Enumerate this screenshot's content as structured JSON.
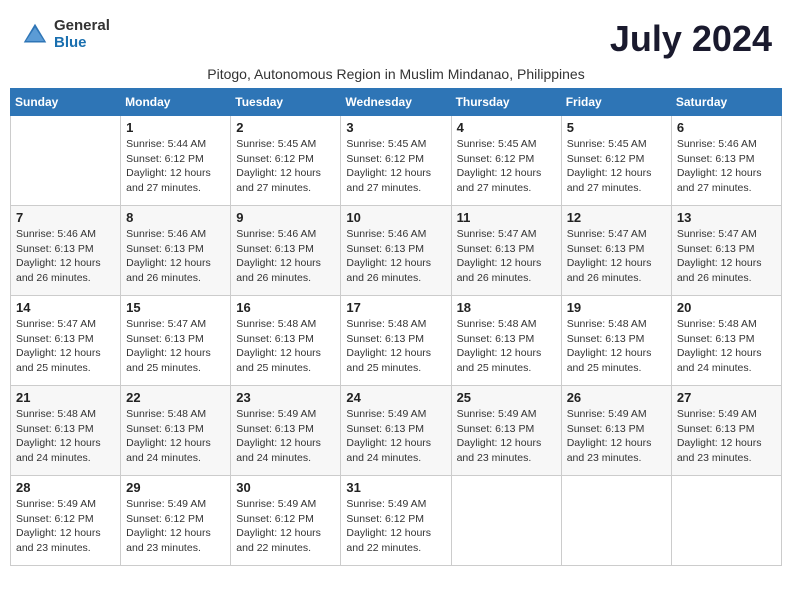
{
  "logo": {
    "general": "General",
    "blue": "Blue"
  },
  "title": "July 2024",
  "subtitle": "Pitogo, Autonomous Region in Muslim Mindanao, Philippines",
  "weekdays": [
    "Sunday",
    "Monday",
    "Tuesday",
    "Wednesday",
    "Thursday",
    "Friday",
    "Saturday"
  ],
  "weeks": [
    [
      {
        "day": "",
        "info": ""
      },
      {
        "day": "1",
        "info": "Sunrise: 5:44 AM\nSunset: 6:12 PM\nDaylight: 12 hours\nand 27 minutes."
      },
      {
        "day": "2",
        "info": "Sunrise: 5:45 AM\nSunset: 6:12 PM\nDaylight: 12 hours\nand 27 minutes."
      },
      {
        "day": "3",
        "info": "Sunrise: 5:45 AM\nSunset: 6:12 PM\nDaylight: 12 hours\nand 27 minutes."
      },
      {
        "day": "4",
        "info": "Sunrise: 5:45 AM\nSunset: 6:12 PM\nDaylight: 12 hours\nand 27 minutes."
      },
      {
        "day": "5",
        "info": "Sunrise: 5:45 AM\nSunset: 6:12 PM\nDaylight: 12 hours\nand 27 minutes."
      },
      {
        "day": "6",
        "info": "Sunrise: 5:46 AM\nSunset: 6:13 PM\nDaylight: 12 hours\nand 27 minutes."
      }
    ],
    [
      {
        "day": "7",
        "info": "Sunrise: 5:46 AM\nSunset: 6:13 PM\nDaylight: 12 hours\nand 26 minutes."
      },
      {
        "day": "8",
        "info": "Sunrise: 5:46 AM\nSunset: 6:13 PM\nDaylight: 12 hours\nand 26 minutes."
      },
      {
        "day": "9",
        "info": "Sunrise: 5:46 AM\nSunset: 6:13 PM\nDaylight: 12 hours\nand 26 minutes."
      },
      {
        "day": "10",
        "info": "Sunrise: 5:46 AM\nSunset: 6:13 PM\nDaylight: 12 hours\nand 26 minutes."
      },
      {
        "day": "11",
        "info": "Sunrise: 5:47 AM\nSunset: 6:13 PM\nDaylight: 12 hours\nand 26 minutes."
      },
      {
        "day": "12",
        "info": "Sunrise: 5:47 AM\nSunset: 6:13 PM\nDaylight: 12 hours\nand 26 minutes."
      },
      {
        "day": "13",
        "info": "Sunrise: 5:47 AM\nSunset: 6:13 PM\nDaylight: 12 hours\nand 26 minutes."
      }
    ],
    [
      {
        "day": "14",
        "info": "Sunrise: 5:47 AM\nSunset: 6:13 PM\nDaylight: 12 hours\nand 25 minutes."
      },
      {
        "day": "15",
        "info": "Sunrise: 5:47 AM\nSunset: 6:13 PM\nDaylight: 12 hours\nand 25 minutes."
      },
      {
        "day": "16",
        "info": "Sunrise: 5:48 AM\nSunset: 6:13 PM\nDaylight: 12 hours\nand 25 minutes."
      },
      {
        "day": "17",
        "info": "Sunrise: 5:48 AM\nSunset: 6:13 PM\nDaylight: 12 hours\nand 25 minutes."
      },
      {
        "day": "18",
        "info": "Sunrise: 5:48 AM\nSunset: 6:13 PM\nDaylight: 12 hours\nand 25 minutes."
      },
      {
        "day": "19",
        "info": "Sunrise: 5:48 AM\nSunset: 6:13 PM\nDaylight: 12 hours\nand 25 minutes."
      },
      {
        "day": "20",
        "info": "Sunrise: 5:48 AM\nSunset: 6:13 PM\nDaylight: 12 hours\nand 24 minutes."
      }
    ],
    [
      {
        "day": "21",
        "info": "Sunrise: 5:48 AM\nSunset: 6:13 PM\nDaylight: 12 hours\nand 24 minutes."
      },
      {
        "day": "22",
        "info": "Sunrise: 5:48 AM\nSunset: 6:13 PM\nDaylight: 12 hours\nand 24 minutes."
      },
      {
        "day": "23",
        "info": "Sunrise: 5:49 AM\nSunset: 6:13 PM\nDaylight: 12 hours\nand 24 minutes."
      },
      {
        "day": "24",
        "info": "Sunrise: 5:49 AM\nSunset: 6:13 PM\nDaylight: 12 hours\nand 24 minutes."
      },
      {
        "day": "25",
        "info": "Sunrise: 5:49 AM\nSunset: 6:13 PM\nDaylight: 12 hours\nand 23 minutes."
      },
      {
        "day": "26",
        "info": "Sunrise: 5:49 AM\nSunset: 6:13 PM\nDaylight: 12 hours\nand 23 minutes."
      },
      {
        "day": "27",
        "info": "Sunrise: 5:49 AM\nSunset: 6:13 PM\nDaylight: 12 hours\nand 23 minutes."
      }
    ],
    [
      {
        "day": "28",
        "info": "Sunrise: 5:49 AM\nSunset: 6:12 PM\nDaylight: 12 hours\nand 23 minutes."
      },
      {
        "day": "29",
        "info": "Sunrise: 5:49 AM\nSunset: 6:12 PM\nDaylight: 12 hours\nand 23 minutes."
      },
      {
        "day": "30",
        "info": "Sunrise: 5:49 AM\nSunset: 6:12 PM\nDaylight: 12 hours\nand 22 minutes."
      },
      {
        "day": "31",
        "info": "Sunrise: 5:49 AM\nSunset: 6:12 PM\nDaylight: 12 hours\nand 22 minutes."
      },
      {
        "day": "",
        "info": ""
      },
      {
        "day": "",
        "info": ""
      },
      {
        "day": "",
        "info": ""
      }
    ]
  ]
}
